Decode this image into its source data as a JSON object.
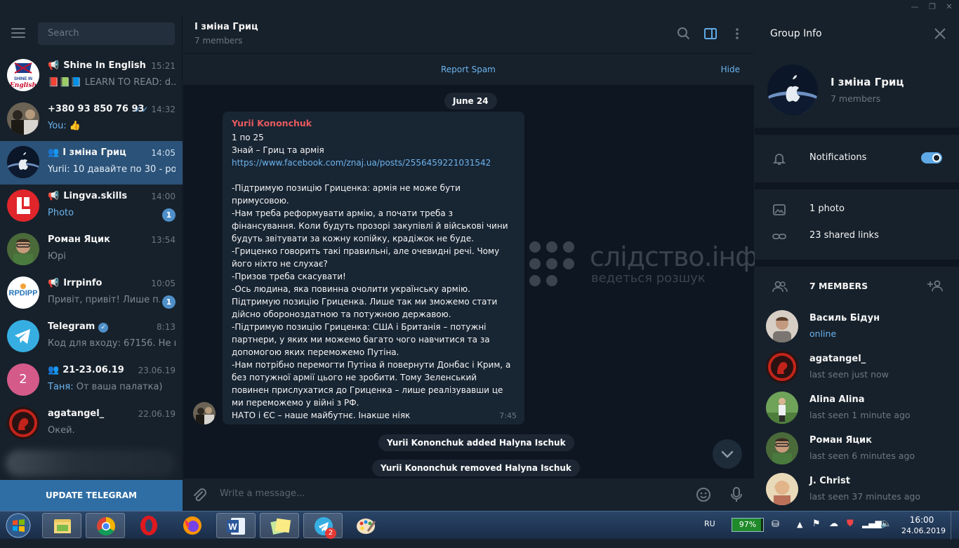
{
  "window": {
    "minimize": "—",
    "restore": "❐",
    "close": "✕"
  },
  "search": {
    "placeholder": "Search"
  },
  "chats": [
    {
      "name": "Shine In English",
      "time": "15:21",
      "preview": "📕📗📘 LEARN TO READ: d...",
      "type": "channel",
      "avatar": "flag"
    },
    {
      "name": "+380 93 850 76 93",
      "time": "14:32",
      "preview_prefix": "You:",
      "preview": " 👍",
      "read": true,
      "avatar": "photo1"
    },
    {
      "name": "І зміна Гриц",
      "time": "14:05",
      "preview": "Yurii: 10 давайте по 30 - роз...",
      "type": "group",
      "active": true,
      "avatar": "apple"
    },
    {
      "name": "Lingva.skills",
      "time": "14:00",
      "preview_prefix": "Photo",
      "preview": "",
      "badge": "1",
      "type": "channel",
      "avatar": "lingva"
    },
    {
      "name": "Роман Яцик",
      "time": "13:54",
      "preview": "Юрі",
      "avatar": "photo2"
    },
    {
      "name": "Irrpinfo",
      "time": "10:05",
      "preview": "Привіт, привіт!  Лише п...",
      "badge": "1",
      "type": "channel",
      "avatar": "irrp"
    },
    {
      "name": "Telegram",
      "time": "8:13",
      "preview": "Код для входу: 67156. Не по...",
      "verified": true,
      "avatar": "telegram"
    },
    {
      "name": "21-23.06.19",
      "time": "23.06.19",
      "preview_prefix": "Таня:",
      "preview": " От ваша палатка)",
      "type": "group",
      "avatar_letter": "2",
      "avatar": "letter"
    },
    {
      "name": "agatangel_",
      "time": "22.06.19",
      "preview": "Окей.",
      "avatar": "agat"
    }
  ],
  "update_label": "UPDATE TELEGRAM",
  "header": {
    "title": "І зміна Гриц",
    "subtitle": "7 members"
  },
  "spam": {
    "report": "Report Spam",
    "hide": "Hide"
  },
  "date_pill": "June 24",
  "message": {
    "author": "Yurii Kononchuk",
    "line1": "1 по 25",
    "line2": "Знай – Гриц та армія",
    "link": "https://www.facebook.com/znaj.ua/posts/2556459221031542",
    "body": "-Підтримую позицію Гриценка: армія не може бути примусовою.\n-Нам треба реформувати армію, а почати треба з фінансування. Коли будуть прозорі закупівлі й військові чини будуть звітувати за кожну копійку, крадіжок не буде.\n-Гриценко говорить такі правильні, але очевидні речі. Чому його ніхто не слухає?\n-Призов треба скасувати!\n-Ось людина, яка повинна очолити українську армію.\nПідтримую позицію Гриценка. Лише так ми зможемо стати дійсно обороноздатною та потужною державою.\n-Підтримую позицію Гриценка: США і Британія – потужні партнери, у яких ми можемо багато чого навчитися та за допомогою яких переможемо Путіна.\n-Нам потрібно перемогти Путіна й повернути Донбас і Крим, а без потужної армії цього не зробити. Тому Зеленський повинен прислухатися до Гриценка – лише реалізувавши це ми переможемо у війні з РФ.\nНАТО і ЄС – наше майбутнє. Інакше ніяк",
    "time": "7:45"
  },
  "service": [
    "Yurii Kononchuk added Halyna Ischuk",
    "Yurii Kononchuk removed Halyna Ischuk"
  ],
  "watermark": {
    "title": "слідство.інфо",
    "subtitle": "ведеться розшук"
  },
  "composer": {
    "placeholder": "Write a message..."
  },
  "info": {
    "title": "Group Info",
    "name": "І зміна Гриц",
    "members": "7 members",
    "notifications": "Notifications",
    "notifications_on": true,
    "photos": "1 photo",
    "links": "23 shared links",
    "members_header": "7 MEMBERS",
    "list": [
      {
        "name": "Василь Бідун",
        "status": "online",
        "online": true
      },
      {
        "name": "agatangel_",
        "status": "last seen just now"
      },
      {
        "name": "Alina Alina",
        "status": "last seen 1 minute ago"
      },
      {
        "name": "Роман Яцик",
        "status": "last seen 6 minutes ago"
      },
      {
        "name": "J. Christ",
        "status": "last seen 37 minutes ago"
      }
    ]
  },
  "taskbar": {
    "lang": "RU",
    "battery": "97%",
    "time": "16:00",
    "date": "24.06.2019",
    "telegram_badge": "2",
    "apps": [
      "start-orb",
      "file-explorer",
      "chrome",
      "opera",
      "firefox",
      "word",
      "sticky-notes",
      "telegram",
      "paint"
    ]
  },
  "colors": {
    "bg": "#17212b",
    "chat_bg": "#0e1621",
    "accent": "#6cb4ee",
    "active": "#2b5278",
    "author": "#e75a5f"
  }
}
